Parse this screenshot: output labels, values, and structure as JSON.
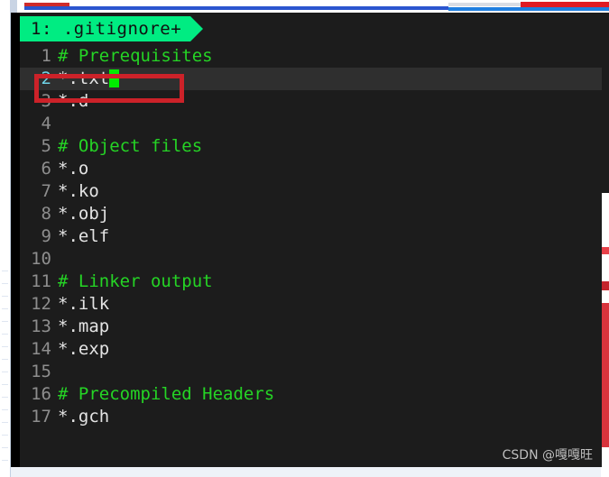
{
  "window": {
    "background_color": "#1c1c1c",
    "accent_green": "#00ec82"
  },
  "tabbar": {
    "tabs": [
      {
        "label": "1: .gitignore+",
        "active": true,
        "modified": true
      }
    ]
  },
  "editor": {
    "cursor_line": 2,
    "cursor_column": 6,
    "comment_color": "#25d425",
    "text_color": "#e4e4e4",
    "gutter_color": "#8e8e8e",
    "current_line_number_color": "#6fd4e8",
    "cursor_color": "#00ee00",
    "current_line_bg": "#2f2f2f",
    "lines": [
      {
        "num": "1",
        "text": "# Prerequisites",
        "type": "comment"
      },
      {
        "num": "2",
        "text": "*.txt",
        "type": "text",
        "current": true,
        "cursor": true
      },
      {
        "num": "3",
        "text": "*.d",
        "type": "text"
      },
      {
        "num": "4",
        "text": "",
        "type": "text"
      },
      {
        "num": "5",
        "text": "# Object files",
        "type": "comment"
      },
      {
        "num": "6",
        "text": "*.o",
        "type": "text"
      },
      {
        "num": "7",
        "text": "*.ko",
        "type": "text"
      },
      {
        "num": "8",
        "text": "*.obj",
        "type": "text"
      },
      {
        "num": "9",
        "text": "*.elf",
        "type": "text"
      },
      {
        "num": "10",
        "text": "",
        "type": "text"
      },
      {
        "num": "11",
        "text": "# Linker output",
        "type": "comment"
      },
      {
        "num": "12",
        "text": "*.ilk",
        "type": "text"
      },
      {
        "num": "13",
        "text": "*.map",
        "type": "text"
      },
      {
        "num": "14",
        "text": "*.exp",
        "type": "text"
      },
      {
        "num": "15",
        "text": "",
        "type": "text"
      },
      {
        "num": "16",
        "text": "# Precompiled Headers",
        "type": "comment"
      },
      {
        "num": "17",
        "text": "*.gch",
        "type": "text"
      }
    ]
  },
  "annotation": {
    "shape": "rectangle",
    "color": "#cc2229",
    "targets_line": "2"
  },
  "watermark": {
    "text": "CSDN @嘎嘎旺"
  }
}
